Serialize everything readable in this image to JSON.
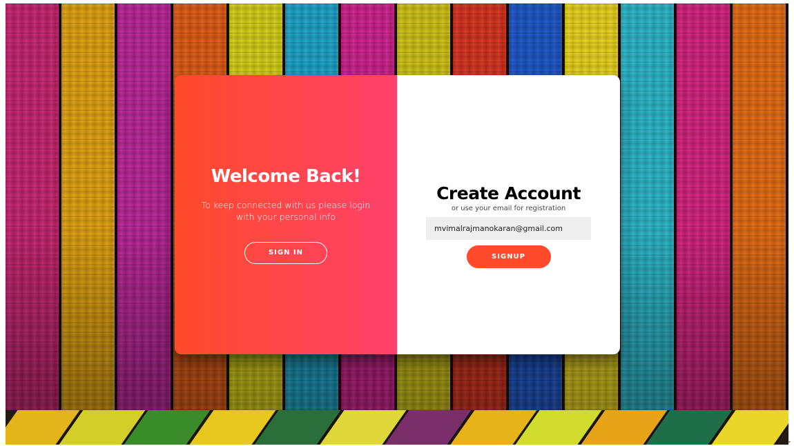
{
  "background": {
    "plank_colors": [
      "#c5226e",
      "#e0a10c",
      "#b82396",
      "#e05a12",
      "#d6cf14",
      "#1aa3c8",
      "#ce1f8c",
      "#cfc212",
      "#d6311c",
      "#1a55c6",
      "#e8d31a",
      "#28b6c8",
      "#d4207e",
      "#e46a10"
    ],
    "floor_colors": [
      "#e3b51a",
      "#d4ce28",
      "#3a8b2a",
      "#e8c81e",
      "#2a6e3a",
      "#e0d83a",
      "#7a2e6a",
      "#e6b418",
      "#d2dc2c",
      "#e8a418",
      "#1e6e4a",
      "#ead628"
    ],
    "scroll_icon": "arrow-down-icon"
  },
  "overlay": {
    "title": "Welcome Back!",
    "text": "To keep connected with us please login with your personal info",
    "button_label": "SIGN IN",
    "gradient_start": "#ff4b2b",
    "gradient_end": "#ff416c"
  },
  "form": {
    "title": "Create Account",
    "subtitle": "or use your email for registration",
    "email_value": "mvimalrajmanokaran@gmail.com",
    "button_label": "SIGNUP",
    "accent": "#ff4b2b"
  }
}
